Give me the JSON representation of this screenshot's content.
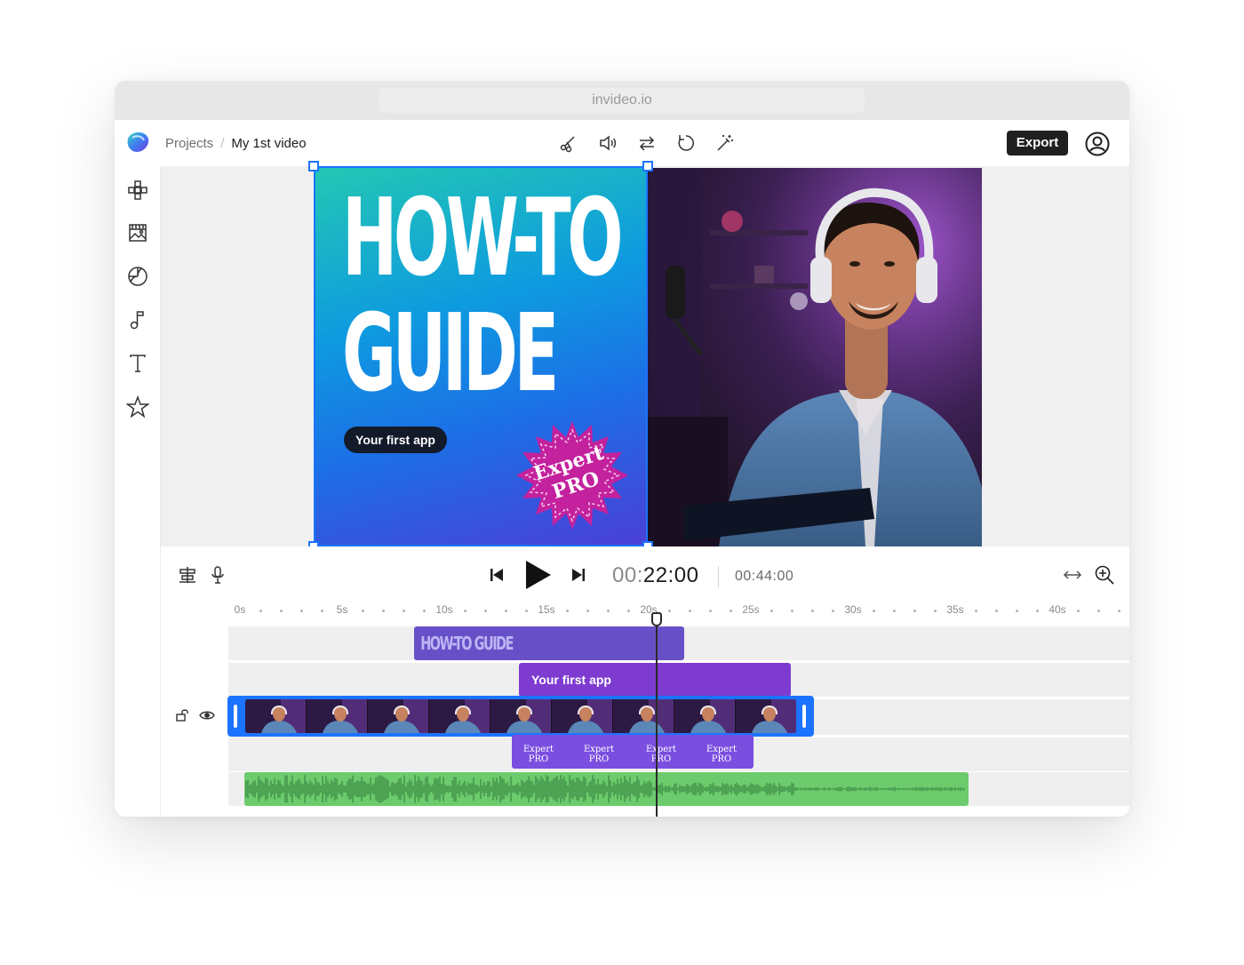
{
  "browser": {
    "url": "invideo.io"
  },
  "header": {
    "breadcrumb": {
      "projects": "Projects",
      "separator": "/",
      "current": "My 1st video"
    },
    "toolbar": [
      "scissors-icon",
      "volume-icon",
      "swap-icon",
      "rotate-icon",
      "magic-wand-icon"
    ],
    "export_label": "Export",
    "account_icon": "user-circle-icon"
  },
  "sidebar": {
    "items": [
      "elements-icon",
      "media-icon",
      "shapes-icon",
      "music-icon",
      "text-icon",
      "star-icon"
    ]
  },
  "canvas": {
    "title_line1": "HOW-TO",
    "title_line2": "GUIDE",
    "subtitle_pill": "Your first app",
    "badge_line1": "Expert",
    "badge_line2": "PRO",
    "gradient": [
      "#23c7b4",
      "#0e9ae0",
      "#1c6fe6",
      "#4b3fd6"
    ],
    "badge_color": "#c4219e"
  },
  "timeline": {
    "current_time_prefix": "00:",
    "current_time_rest": "22:00",
    "total_time": "00:44:00",
    "ruler_labels": [
      "0s",
      "5s",
      "10s",
      "15s",
      "20s",
      "25s",
      "30s",
      "35s",
      "40s"
    ],
    "clips": {
      "title": "HOW-TO GUIDE",
      "subtitle": "Your first app",
      "sticker_line1": "Expert",
      "sticker_line2": "PRO"
    },
    "colors": {
      "title_clip": "#6750c7",
      "text_clip": "#7e3bd0",
      "video_border": "#1c73ff",
      "sticker_clip": "#7a4fe0",
      "audio_clip": "#6ccb6c"
    }
  }
}
